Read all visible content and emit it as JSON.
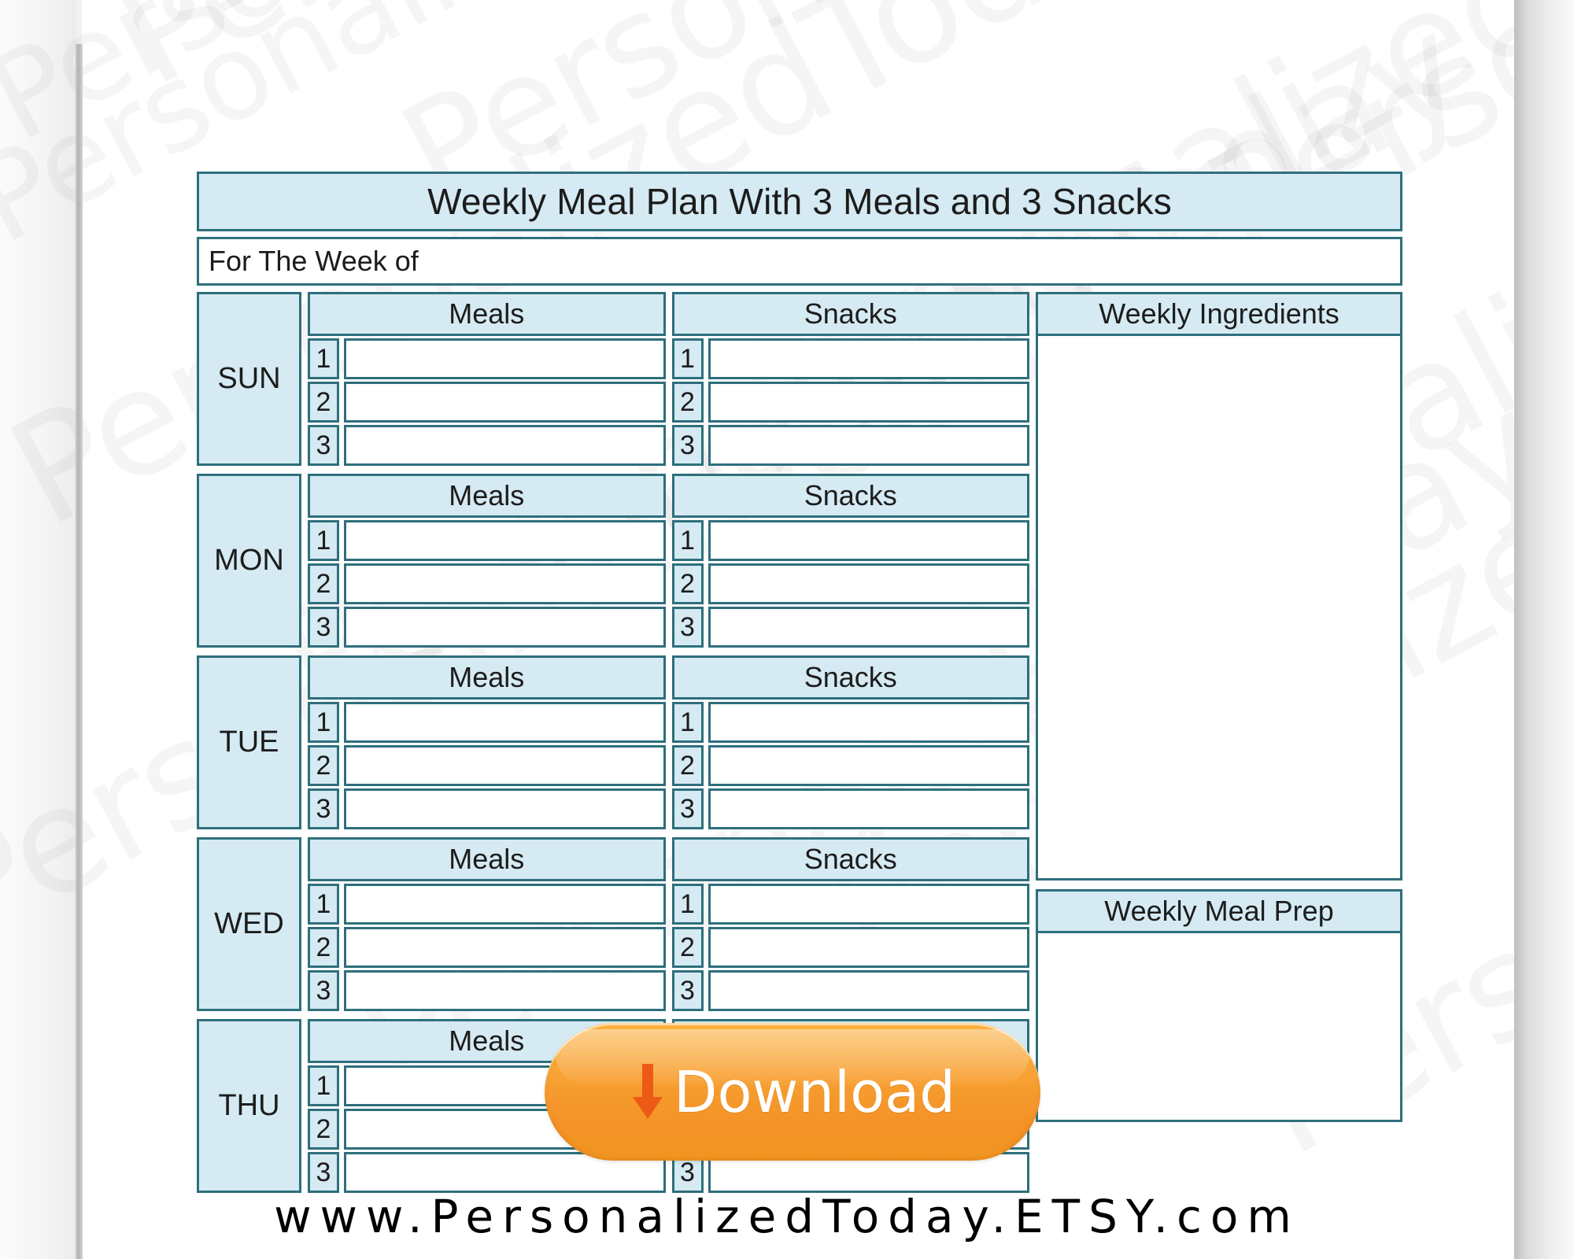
{
  "document": {
    "title": "Weekly Meal Plan With 3 Meals and 3 Snacks",
    "week_of_label": "For The Week of"
  },
  "columns": {
    "meals_header": "Meals",
    "snacks_header": "Snacks",
    "ingredients_header": "Weekly Ingredients",
    "meal_prep_header": "Weekly Meal Prep"
  },
  "row_numbers": [
    "1",
    "2",
    "3"
  ],
  "days": [
    {
      "label": "SUN",
      "meals": [
        "",
        "",
        ""
      ],
      "snacks": [
        "",
        "",
        ""
      ]
    },
    {
      "label": "MON",
      "meals": [
        "",
        "",
        ""
      ],
      "snacks": [
        "",
        "",
        ""
      ]
    },
    {
      "label": "TUE",
      "meals": [
        "",
        "",
        ""
      ],
      "snacks": [
        "",
        "",
        ""
      ]
    },
    {
      "label": "WED",
      "meals": [
        "",
        "",
        ""
      ],
      "snacks": [
        "",
        "",
        ""
      ]
    },
    {
      "label": "THU",
      "meals": [
        "",
        "",
        ""
      ],
      "snacks": [
        "",
        "",
        ""
      ]
    }
  ],
  "download_button": {
    "label": "Download",
    "icon": "down-arrow-icon",
    "color": "#f7a033",
    "arrow_color": "#ed5a16",
    "text_color": "#ffffff"
  },
  "watermark": {
    "url_text": "www.PersonalizedToday.ETSY.com",
    "diagonal_text": "PersonalizedToday",
    "diagonal_fragments": [
      "Personalized",
      "Personal",
      "PersonalizedToday",
      "edToday",
      "Today",
      "dToday",
      "Personali",
      "zedToda"
    ]
  },
  "theme": {
    "accent_fill": "#d5eaf2",
    "border": "#2e6f7c",
    "page_background": "#ffffff",
    "canvas_background": "#f2f2f2",
    "text": "#1c1c1c"
  }
}
